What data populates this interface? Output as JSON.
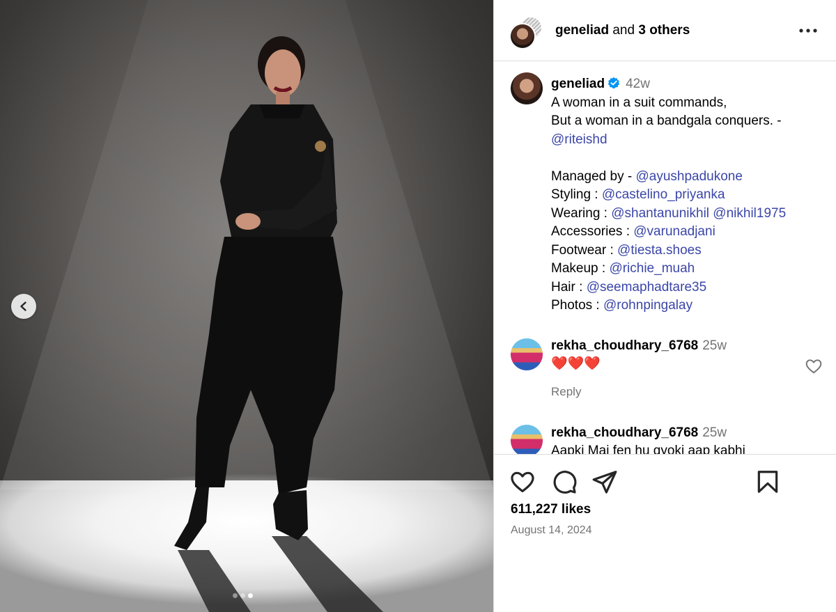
{
  "header": {
    "owner": "geneliad",
    "and_text": "and",
    "others": "3 others",
    "more_label": "More options"
  },
  "media": {
    "slide_count": 3,
    "active_slide": 3,
    "prev_label": "Go back"
  },
  "caption": {
    "username": "geneliad",
    "verified": true,
    "time": "42w",
    "line1": "A woman in a suit commands,",
    "line2": "But a woman in a bandgala conquers. -",
    "line2_mention": "@riteishd",
    "credits": [
      {
        "label": "Managed by - ",
        "mentions": [
          "@ayushpadukone"
        ]
      },
      {
        "label": "Styling : ",
        "mentions": [
          "@castelino_priyanka"
        ]
      },
      {
        "label": "Wearing : ",
        "mentions": [
          "@shantanunikhil",
          "@nikhil1975"
        ]
      },
      {
        "label": "Accessories : ",
        "mentions": [
          "@varunadjani"
        ]
      },
      {
        "label": "Footwear : ",
        "mentions": [
          "@tiesta.shoes"
        ]
      },
      {
        "label": "Makeup : ",
        "mentions": [
          "@richie_muah"
        ]
      },
      {
        "label": "Hair : ",
        "mentions": [
          "@seemaphadtare35"
        ]
      },
      {
        "label": "Photos : ",
        "mentions": [
          "@rohnpingalay"
        ]
      }
    ]
  },
  "comments": [
    {
      "username": "rekha_choudhary_6768",
      "time": "25w",
      "text": "❤️❤️❤️",
      "reply_label": "Reply"
    },
    {
      "username": "rekha_choudhary_6768",
      "time": "25w",
      "text": "Aapki Mai fen hu qyoki aap kabhi"
    }
  ],
  "footer": {
    "likes": "611,227 likes",
    "date": "August 14, 2024"
  },
  "colors": {
    "mention": "#3b46a8",
    "secondary_text": "#737373",
    "border": "#dbdbdb",
    "verified": "#0095f6"
  },
  "icons": [
    "chevron-left-icon",
    "more-icon",
    "verified-icon",
    "heart-icon",
    "comment-icon",
    "share-icon",
    "bookmark-icon"
  ]
}
